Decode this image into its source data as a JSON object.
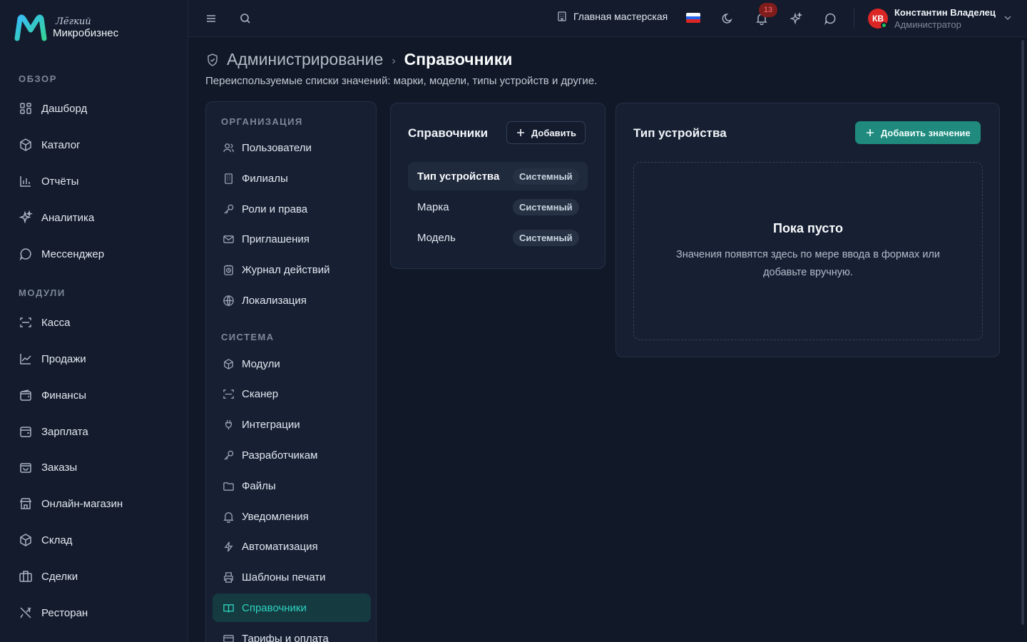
{
  "brand": {
    "line1": "Лёгкий",
    "line2": "Микробизнес"
  },
  "sidebar": {
    "sections": [
      {
        "label": "ОБЗОР"
      },
      {
        "label": "МОДУЛИ"
      }
    ],
    "items": [
      {
        "label": "Дашборд",
        "icon": "dashboard-icon"
      },
      {
        "label": "Каталог",
        "icon": "catalog-icon"
      },
      {
        "label": "Отчёты",
        "icon": "reports-icon"
      },
      {
        "label": "Аналитика",
        "icon": "sparkles-icon"
      },
      {
        "label": "Мессенджер",
        "icon": "message-icon"
      },
      {
        "label": "Касса",
        "icon": "scan-icon"
      },
      {
        "label": "Продажи",
        "icon": "trend-icon"
      },
      {
        "label": "Финансы",
        "icon": "wallet-icon"
      },
      {
        "label": "Зарплата",
        "icon": "wallet-icon"
      },
      {
        "label": "Заказы",
        "icon": "bag-icon"
      },
      {
        "label": "Онлайн-магазин",
        "icon": "store-icon"
      },
      {
        "label": "Склад",
        "icon": "box-icon"
      },
      {
        "label": "Сделки",
        "icon": "briefcase-icon"
      },
      {
        "label": "Ресторан",
        "icon": "utensils-icon"
      }
    ]
  },
  "topbar": {
    "workspace": "Главная мастерская",
    "language": "RU",
    "notifications_count": "13",
    "user": {
      "initials": "КВ",
      "name": "Константин Владелец",
      "role": "Администратор"
    }
  },
  "header": {
    "crumb_parent": "Администрирование",
    "crumb_separator": "›",
    "crumb_current": "Справочники",
    "subtitle": "Переиспользуемые списки значений: марки, модели, типы устройств и другие."
  },
  "admin_nav": {
    "sections": [
      {
        "label": "ОРГАНИЗАЦИЯ"
      },
      {
        "label": "СИСТЕМА"
      }
    ],
    "items": [
      {
        "label": "Пользователи",
        "icon": "users-icon"
      },
      {
        "label": "Филиалы",
        "icon": "building-icon"
      },
      {
        "label": "Роли и права",
        "icon": "key-icon"
      },
      {
        "label": "Приглашения",
        "icon": "mail-icon"
      },
      {
        "label": "Журнал действий",
        "icon": "log-icon"
      },
      {
        "label": "Локализация",
        "icon": "globe-icon"
      },
      {
        "label": "Модули",
        "icon": "cube-icon"
      },
      {
        "label": "Сканер",
        "icon": "scan-icon"
      },
      {
        "label": "Интеграции",
        "icon": "plug-icon"
      },
      {
        "label": "Разработчикам",
        "icon": "key-icon"
      },
      {
        "label": "Файлы",
        "icon": "folder-icon"
      },
      {
        "label": "Уведомления",
        "icon": "bell-icon"
      },
      {
        "label": "Автоматизация",
        "icon": "bolt-icon"
      },
      {
        "label": "Шаблоны печати",
        "icon": "printer-icon"
      },
      {
        "label": "Справочники",
        "icon": "book-icon",
        "active": true
      },
      {
        "label": "Тарифы и оплата",
        "icon": "card-icon"
      }
    ]
  },
  "directories": {
    "title": "Справочники",
    "add_label": "Добавить",
    "rows": [
      {
        "name": "Тип устройства",
        "tag": "Системный",
        "active": true
      },
      {
        "name": "Марка",
        "tag": "Системный"
      },
      {
        "name": "Модель",
        "tag": "Системный"
      }
    ]
  },
  "values": {
    "title": "Тип устройства",
    "add_label": "Добавить значение",
    "empty_title": "Пока пусто",
    "empty_text": "Значения появятся здесь по мере ввода в формах или добавьте вручную."
  },
  "colors": {
    "accent": "#1f8a7d",
    "accent_text": "#2dd4bf",
    "badge_bg": "#7f1d1d",
    "avatar_bg": "#dc2626",
    "online": "#22c55e"
  }
}
